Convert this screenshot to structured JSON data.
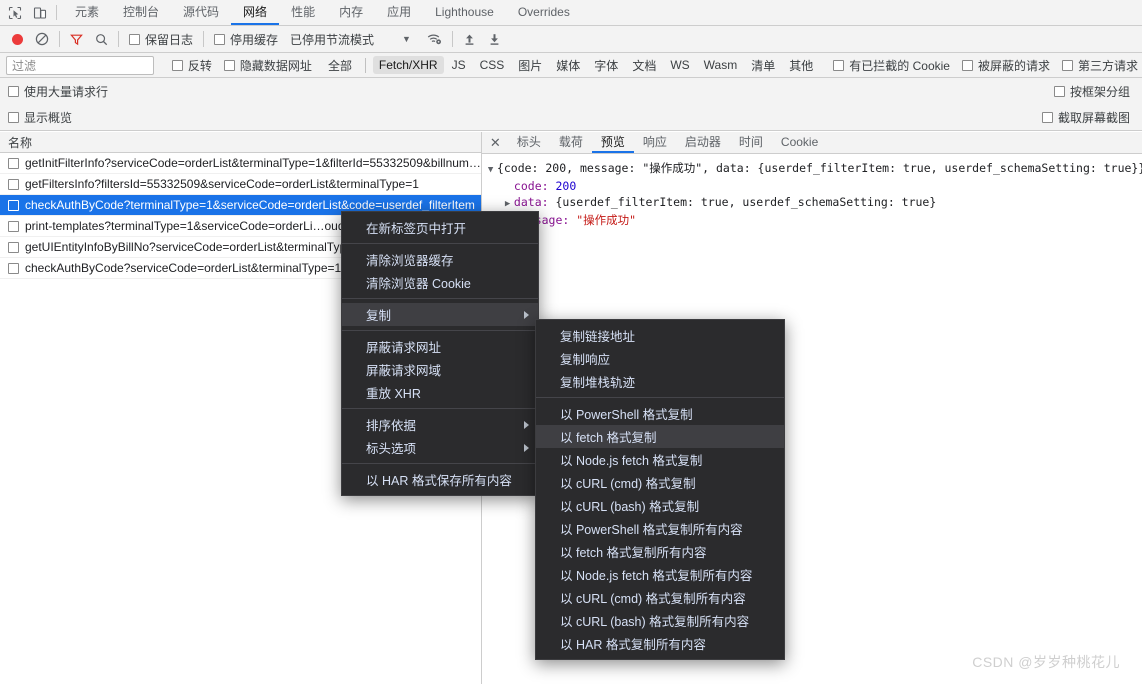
{
  "devtools": {
    "main_tabs": [
      {
        "label": "元素",
        "active": false
      },
      {
        "label": "控制台",
        "active": false
      },
      {
        "label": "源代码",
        "active": false
      },
      {
        "label": "网络",
        "active": true
      },
      {
        "label": "性能",
        "active": false
      },
      {
        "label": "内存",
        "active": false
      },
      {
        "label": "应用",
        "active": false
      },
      {
        "label": "Lighthouse",
        "active": false
      },
      {
        "label": "Overrides",
        "active": false
      }
    ],
    "left_icons": [
      {
        "name": "inspect-element-icon"
      },
      {
        "name": "device-toolbar-icon"
      }
    ]
  },
  "network_toolbar": {
    "record_button": "record-button",
    "clear_button": "clear-button",
    "filter_icon": "filter-icon",
    "search_icon": "search-icon",
    "preserve_log_label": "保留日志",
    "disable_cache_label": "停用缓存",
    "throttling_label": "已停用节流模式",
    "throttling_caret": "▼",
    "network_conditions_icon": "wifi-settings-icon",
    "import_har_icon": "upload-icon",
    "export_har_icon": "download-icon"
  },
  "filter_bar": {
    "filter_placeholder": "过滤",
    "invert_label": "反转",
    "hide_data_urls_label": "隐藏数据网址",
    "types": [
      {
        "label": "全部",
        "selected": false
      },
      {
        "label": "Fetch/XHR",
        "selected": true
      },
      {
        "label": "JS",
        "selected": false
      },
      {
        "label": "CSS",
        "selected": false
      },
      {
        "label": "图片",
        "selected": false
      },
      {
        "label": "媒体",
        "selected": false
      },
      {
        "label": "字体",
        "selected": false
      },
      {
        "label": "文档",
        "selected": false
      },
      {
        "label": "WS",
        "selected": false
      },
      {
        "label": "Wasm",
        "selected": false
      },
      {
        "label": "清单",
        "selected": false
      },
      {
        "label": "其他",
        "selected": false
      }
    ],
    "blocked_cookies_label": "有已拦截的 Cookie",
    "blocked_requests_label": "被屏蔽的请求",
    "third_party_label": "第三方请求"
  },
  "options_rows": {
    "big_request_rows_label": "使用大量请求行",
    "group_by_frame_label": "按框架分组",
    "show_overview_label": "显示概览",
    "capture_screenshots_label": "截取屏幕截图"
  },
  "request_list": {
    "column_header": "名称",
    "rows": [
      {
        "name": "getInitFilterInfo?serviceCode=orderList&terminalType=1&filterId=55332509&billnum…",
        "selected": false
      },
      {
        "name": "getFiltersInfo?filtersId=55332509&serviceCode=orderList&terminalType=1",
        "selected": false
      },
      {
        "name": "checkAuthByCode?terminalType=1&serviceCode=orderList&code=userdef_filterItem",
        "selected": true
      },
      {
        "name": "print-templates?terminalType=1&serviceCode=orderLi…oud",
        "selected": false
      },
      {
        "name": "getUIEntityInfoByBillNo?serviceCode=orderList&terminalType=1",
        "selected": false
      },
      {
        "name": "checkAuthByCode?serviceCode=orderList&terminalType=1&",
        "selected": false
      }
    ]
  },
  "detail_panel": {
    "close_icon": "close-icon",
    "tabs": [
      {
        "label": "标头",
        "active": false
      },
      {
        "label": "载荷",
        "active": false
      },
      {
        "label": "预览",
        "active": true
      },
      {
        "label": "响应",
        "active": false
      },
      {
        "label": "启动器",
        "active": false
      },
      {
        "label": "时间",
        "active": false
      },
      {
        "label": "Cookie",
        "active": false
      }
    ],
    "preview": {
      "line1": {
        "triangle": "▼",
        "text": "{code: 200, message: \"操作成功\", data: {userdef_filterItem: true, userdef_schemaSetting: true}}"
      },
      "line2": {
        "key": "code:",
        "value": "200"
      },
      "line3": {
        "triangle": "▶",
        "key": "data:",
        "value": "{userdef_filterItem: true, userdef_schemaSetting: true}"
      },
      "line4": {
        "key": "message:",
        "value": "\"操作成功\""
      }
    }
  },
  "context_menu": {
    "items": [
      {
        "label": "在新标签页中打开",
        "submenu": false,
        "highlight": false,
        "sep_after": true
      },
      {
        "label": "清除浏览器缓存",
        "submenu": false,
        "highlight": false,
        "sep_after": false
      },
      {
        "label": "清除浏览器 Cookie",
        "submenu": false,
        "highlight": false,
        "sep_after": true
      },
      {
        "label": "复制",
        "submenu": true,
        "highlight": true,
        "sep_after": true
      },
      {
        "label": "屏蔽请求网址",
        "submenu": false,
        "highlight": false,
        "sep_after": false
      },
      {
        "label": "屏蔽请求网域",
        "submenu": false,
        "highlight": false,
        "sep_after": false
      },
      {
        "label": "重放 XHR",
        "submenu": false,
        "highlight": false,
        "sep_after": true
      },
      {
        "label": "排序依据",
        "submenu": true,
        "highlight": false,
        "sep_after": false
      },
      {
        "label": "标头选项",
        "submenu": true,
        "highlight": false,
        "sep_after": true
      },
      {
        "label": "以 HAR 格式保存所有内容",
        "submenu": false,
        "highlight": false,
        "sep_after": false
      }
    ]
  },
  "copy_submenu": {
    "items": [
      {
        "label": "复制链接地址",
        "highlight": false,
        "sep_after": false
      },
      {
        "label": "复制响应",
        "highlight": false,
        "sep_after": false
      },
      {
        "label": "复制堆栈轨迹",
        "highlight": false,
        "sep_after": true
      },
      {
        "label": "以 PowerShell 格式复制",
        "highlight": false,
        "sep_after": false
      },
      {
        "label": "以 fetch 格式复制",
        "highlight": true,
        "sep_after": false
      },
      {
        "label": "以 Node.js fetch 格式复制",
        "highlight": false,
        "sep_after": false
      },
      {
        "label": "以 cURL (cmd) 格式复制",
        "highlight": false,
        "sep_after": false
      },
      {
        "label": "以 cURL (bash) 格式复制",
        "highlight": false,
        "sep_after": false
      },
      {
        "label": "以 PowerShell 格式复制所有内容",
        "highlight": false,
        "sep_after": false
      },
      {
        "label": "以 fetch 格式复制所有内容",
        "highlight": false,
        "sep_after": false
      },
      {
        "label": "以 Node.js fetch 格式复制所有内容",
        "highlight": false,
        "sep_after": false
      },
      {
        "label": "以 cURL (cmd) 格式复制所有内容",
        "highlight": false,
        "sep_after": false
      },
      {
        "label": "以 cURL (bash) 格式复制所有内容",
        "highlight": false,
        "sep_after": false
      },
      {
        "label": "以 HAR 格式复制所有内容",
        "highlight": false,
        "sep_after": false
      }
    ]
  },
  "watermark": {
    "text": "CSDN @岁岁种桃花儿"
  },
  "colors": {
    "accent": "#1a73e8",
    "record": "#ec3b3b",
    "filter_red": "#d93025",
    "menu_bg": "#2b2b2d",
    "menu_highlight": "#3f3f43",
    "toolbar_bg": "#f3f3f3"
  }
}
